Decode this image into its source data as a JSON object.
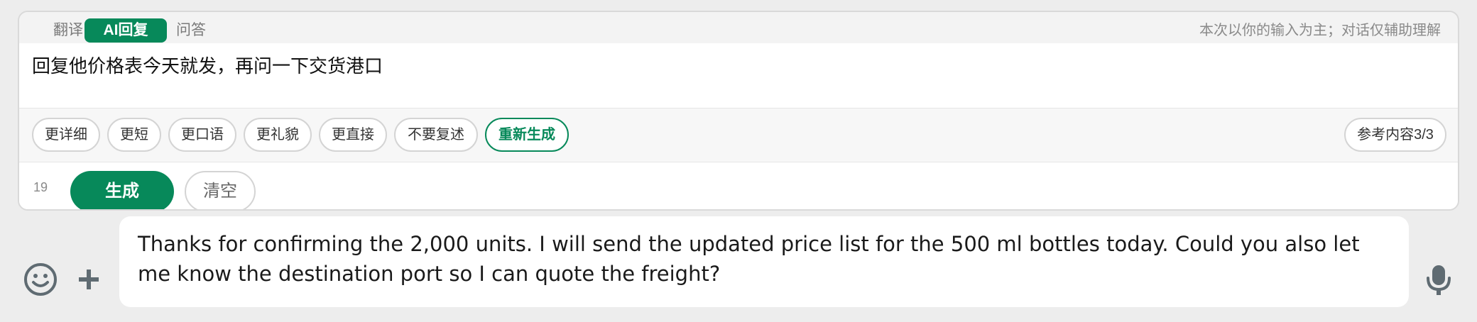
{
  "modes": {
    "translate": "翻译",
    "ai_reply": "AI回复",
    "qa": "问答"
  },
  "hint": "本次以你的输入为主；对话仅辅助理解",
  "instruction": "回复他价格表今天就发，再问一下交货港口",
  "chips": [
    "更详细",
    "更短",
    "更口语",
    "更礼貌",
    "更直接",
    "不要复述"
  ],
  "regenerate_label": "重新生成",
  "reference_label": "参考内容3/3",
  "char_count": "19",
  "generate_label": "生成",
  "clear_label": "清空",
  "message_text": "Thanks for confirming the 2,000 units. I will send the updated price list for the 500 ml bottles today. Could you also let me know the destination port so I can quote the freight?",
  "colors": {
    "accent": "#07895a",
    "background": "#ededed"
  },
  "icons": {
    "emoji": "emoji-icon",
    "add": "plus-icon",
    "voice": "microphone-icon"
  }
}
